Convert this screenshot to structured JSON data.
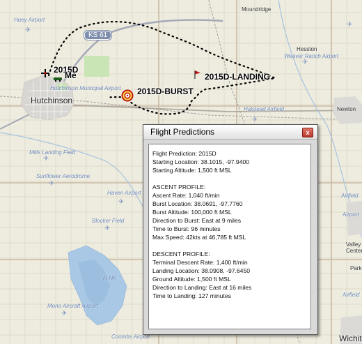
{
  "map": {
    "towns": {
      "hutchinson": "Hutchinson",
      "moundridge": "Moundridge",
      "hesston": "Hesston",
      "newton": "Newton",
      "halstead": "Halstead Airfield",
      "valley_center": "Valley\nCenter",
      "park": "Park",
      "wichita": "Wichit"
    },
    "airports": {
      "huey": "Huey Airport",
      "hutch_muni": "Hutchinson Municipal Airport",
      "weaver": "Weaver Ranch Airport",
      "mills": "Mills Landing Field",
      "sunflower": "Sunflower Aerodrome",
      "haven": "Haven Airport",
      "blocker": "Blocker Field",
      "rnk": "R-NK",
      "mono": "Mono Aircraft Airport",
      "coombs": "Coombs Airport",
      "right1": "Airfield",
      "right2": "Airport",
      "right3": "Airfield"
    },
    "highway": "KS 61",
    "markers": {
      "me": "Me",
      "launch": "2015D",
      "burst": "2015D-BURST",
      "landing": "2015D-LANDING"
    }
  },
  "dialog": {
    "title": "Flight Predictions",
    "close_symbol": "x",
    "general": [
      "Flight Prediction: 2015D",
      "Starting Location: 38.1015, -97.9400",
      "Starting Altitude: 1,500 ft MSL"
    ],
    "ascent_header": "ASCENT PROFILE:",
    "ascent": [
      "Ascent Rate: 1,040 ft/min",
      "Burst Location: 38.0691, -97.7760",
      "Burst Altitude: 100,000 ft MSL",
      "Direction to Burst: East at 9 miles",
      "Time to Burst: 96 minutes",
      "Max Speed: 42kts at 46,785 ft MSL"
    ],
    "descent_header": "DESCENT PROFILE:",
    "descent": [
      "Terminal Descent Rate: 1,400 ft/min",
      "Landing Location: 38.0908, -97.6450",
      "Ground Altitude: 1,500 ft MSL",
      "Direction to Landing: East at 16 miles",
      "Time to Landing: 127 minutes"
    ]
  }
}
